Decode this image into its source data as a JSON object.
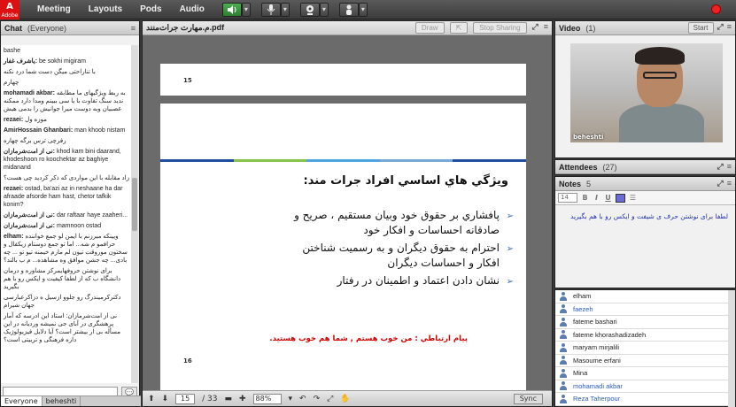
{
  "menubar": {
    "logo_text": "Adobe",
    "items": [
      "Meeting",
      "Layouts",
      "Pods",
      "Audio"
    ]
  },
  "chat": {
    "title": "Chat",
    "scope": "(Everyone)",
    "messages": [
      {
        "who": "",
        "text": "bashe"
      },
      {
        "who": "یاشرف غفار:",
        "text": "be  sokhi migiram"
      },
      {
        "who": "",
        "text": "با تناراحتی میگن دست شما درد نکنه"
      },
      {
        "who": "",
        "text": "چهارم"
      },
      {
        "who": "mohamadi akbar:",
        "text": "به ربط ویژگیهای ما مطابقه ندید سنگ تفاوت با یا سی ببینم ومدا دارد ممکنه عصبیان وبه دوست میرا جوانیش را بدمی هیش"
      },
      {
        "who": "rezaei:",
        "text": "موزه ول"
      },
      {
        "who": "AmirHossain Ghanbari:",
        "text": "man khoob nistam"
      },
      {
        "who": "",
        "text": "رفرچی ترس برگه چهاره"
      },
      {
        "who": "نی از امت‌شرمازان:",
        "text": "khod kam bini daarand, khodeshoon ro koochektar az baghiye midanand"
      },
      {
        "who": "",
        "text": "زاد مقابله با این مواردی که ذکر کردید چی هست؟"
      },
      {
        "who": "rezaei:",
        "text": "ostad, ba'azi az in neshaane ha dar afraade afsorde ham hast, chetor tafkik konim?"
      },
      {
        "who": "نی از امت‌شرمازان:",
        "text": "dar raftaar haye zaaheri..."
      },
      {
        "who": "نی از امت‌شرمازان:",
        "text": "mamnoon ostad"
      },
      {
        "who": "elham:",
        "text": "ویینکه میرزنم با ایمن لو جمع خواننده حرافمو م شه... اما تو جمع دوستام زیکفال و سختون موروقت تیون لم مارم خیمنه تیو تو ... چه بادی... چه جشن موافق وه مشاهده... م ب بالند؟"
      },
      {
        "who": "",
        "text": "برای نوشتن حروفهایمرکز مشاوره و درمان دانشگاه ب که از لطفا کیفیت و ایکس رو با هم بگیرید"
      },
      {
        "who": "",
        "text": "دکترکرمیندرگ رو جلوو ازسیل ه دزاکرعبارسی جهان شیرام"
      },
      {
        "who": "",
        "text": "نی از امت‌شرمازان: استاد این ادرسه که آمار پرهشگری در آبای جی نمیشه وردیانه در این مسأله بی ار بیشتر است؟ آیا دلایل فیزیولوژیک داره فرهنگی و تربیتی است؟"
      }
    ],
    "tabs": [
      "Everyone",
      "beheshti"
    ],
    "send_glyph": "💬"
  },
  "share": {
    "title": "م.مهارت جرات‌منند.pdf",
    "draw_label": "Draw",
    "stop_sharing_label": "Stop Sharing",
    "slide_top_number": "15",
    "slide_number": "16",
    "slide_title": "ویژگي هاي اساسي افراد جرات مند:",
    "bullets": [
      "پافشاري بر حقوق خود وبيان مستقيم ، صريح و صادقانه احساسات و افكار خود",
      "احترام به حقوق ديگران و به رسميت شناختن افكار و احساسات ديگران",
      "نشان دادن اعتماد و اطمينان در رفتار"
    ],
    "message": "پيام ارتباطي : من خوب هستم , شما هم خوب هستيد.",
    "stripe_colors": [
      "#1f4e9e",
      "#8bc34a",
      "#4fa3e0",
      "#7aa7d6",
      "#1f4e9e"
    ],
    "page_current": "15",
    "page_total": "/ 33",
    "zoom": "88%",
    "sync_label": "Sync"
  },
  "video": {
    "title": "Video",
    "count": "(1)",
    "start_label": "Start",
    "camera_name": "beheshti"
  },
  "attendees": {
    "title": "Attendees",
    "count": "(27)",
    "list": [
      {
        "name": "elham",
        "blue": false
      },
      {
        "name": "faezeh",
        "blue": true
      },
      {
        "name": "fateme bashari",
        "blue": false
      },
      {
        "name": "fateme khorashadizadeh",
        "blue": false
      },
      {
        "name": "maryam mirjalili",
        "blue": false
      },
      {
        "name": "Masoume erfani",
        "blue": false
      },
      {
        "name": "Mina",
        "blue": false
      },
      {
        "name": "mohamadi akbar",
        "blue": true
      },
      {
        "name": "Reza Taherpour",
        "blue": true
      }
    ]
  },
  "notes": {
    "title": "Notes",
    "count": "5",
    "font_size": "14",
    "text": "لطفا برای نوشتن حرف ی شیفت و ایکس رو با هم بگیرید"
  }
}
